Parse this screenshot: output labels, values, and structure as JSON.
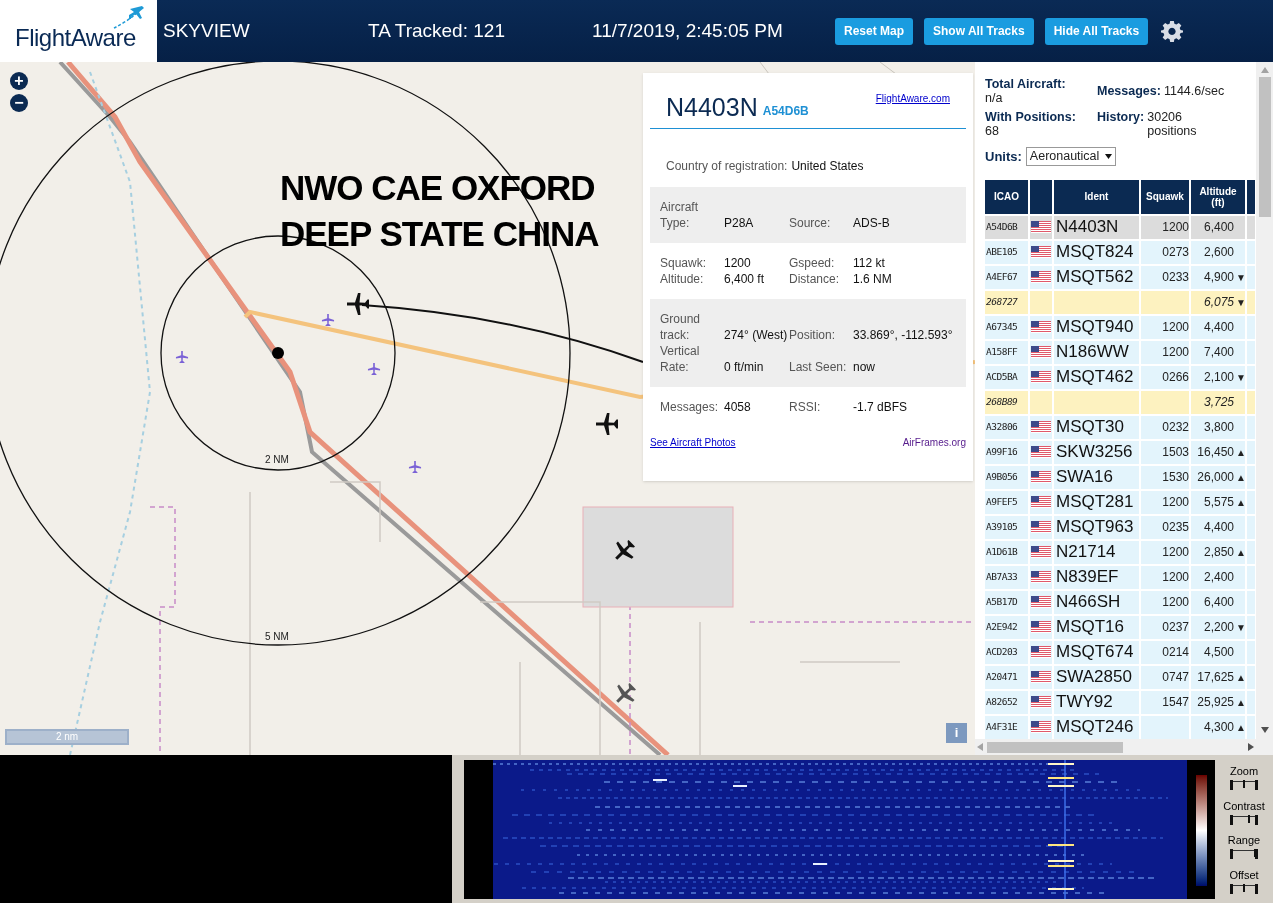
{
  "header": {
    "logo": "FlightAware",
    "title": "SKYVIEW",
    "tracked": "TA Tracked: 121",
    "datetime": "11/7/2019, 2:45:05 PM",
    "buttons": [
      "Reset Map",
      "Show All Tracks",
      "Hide All Tracks"
    ]
  },
  "map": {
    "zoom_buttons": [
      "+",
      "−"
    ],
    "annotation": [
      "NWO CAE OXFORD",
      "DEEP STATE CHINA"
    ],
    "rings": [
      "2 NM",
      "5 NM"
    ],
    "scale": "2 nm",
    "info": "i"
  },
  "popup": {
    "ident": "N4403N",
    "icao": "A54D6B",
    "link": "FlightAware.com",
    "country_label": "Country of registration:",
    "country": "United States",
    "sections": [
      {
        "shaded": true,
        "rows": [
          [
            "Aircraft Type:",
            "P28A",
            "Source:",
            "ADS-B"
          ]
        ]
      },
      {
        "shaded": false,
        "rows": [
          [
            "Squawk:",
            "1200",
            "Gspeed:",
            "112 kt"
          ],
          [
            "Altitude:",
            "6,400 ft",
            "Distance:",
            "1.6 NM"
          ]
        ]
      },
      {
        "shaded": true,
        "rows": [
          [
            "Ground track:",
            "274° (West)",
            "Position:",
            "33.869°, -112.593°"
          ],
          [
            "Vertical Rate:",
            "0 ft/min",
            "Last Seen:",
            "now"
          ]
        ]
      },
      {
        "shaded": false,
        "rows": [
          [
            "Messages:",
            "4058",
            "RSSI:",
            "-1.7 dBFS"
          ]
        ]
      }
    ],
    "photos_link": "See Aircraft Photos",
    "airframes_link": "AirFrames.org"
  },
  "stats": {
    "total_label": "Total Aircraft:",
    "total": "n/a",
    "messages_label": "Messages:",
    "messages": "1144.6/sec",
    "positions_label": "With Positions:",
    "positions": "68",
    "history_label": "History:",
    "history": "30206 positions",
    "units_label": "Units:",
    "units": "Aeronautical"
  },
  "table": {
    "columns": [
      "ICAO",
      "Ident",
      "Squawk",
      "Altitude (ft)"
    ],
    "rows": [
      {
        "kind": "adsb",
        "selected": true,
        "icao": "A54D6B",
        "ident": "N4403N",
        "squawk": "1200",
        "altitude": "6,400"
      },
      {
        "kind": "adsb",
        "selected": false,
        "icao": "ABE105",
        "ident": "MSQT824",
        "squawk": "0273",
        "altitude": "2,600"
      },
      {
        "kind": "adsb",
        "selected": false,
        "icao": "A4EF67",
        "ident": "MSQT562",
        "squawk": "0233",
        "altitude": "4,900",
        "trend": "▼"
      },
      {
        "kind": "mlat",
        "selected": false,
        "icao": "268727",
        "altitude": "6,075",
        "trend": "▼"
      },
      {
        "kind": "adsb",
        "selected": false,
        "icao": "A67345",
        "ident": "MSQT940",
        "squawk": "1200",
        "altitude": "4,400"
      },
      {
        "kind": "adsb",
        "selected": false,
        "icao": "A158FF",
        "ident": "N186WW",
        "squawk": "1200",
        "altitude": "7,400"
      },
      {
        "kind": "adsb",
        "selected": false,
        "icao": "ACD5BA",
        "ident": "MSQT462",
        "squawk": "0266",
        "altitude": "2,100",
        "trend": "▼"
      },
      {
        "kind": "mlat",
        "selected": false,
        "icao": "268B89",
        "altitude": "3,725"
      },
      {
        "kind": "adsb",
        "selected": false,
        "icao": "A32806",
        "ident": "MSQT30",
        "squawk": "0232",
        "altitude": "3,800"
      },
      {
        "kind": "adsb",
        "selected": false,
        "icao": "A99F16",
        "ident": "SKW3256",
        "squawk": "1503",
        "altitude": "16,450",
        "trend": "▲"
      },
      {
        "kind": "adsb",
        "selected": false,
        "icao": "A9B056",
        "ident": "SWA16",
        "squawk": "1530",
        "altitude": "26,000",
        "trend": "▲"
      },
      {
        "kind": "adsb",
        "selected": false,
        "icao": "A9FEF5",
        "ident": "MSQT281",
        "squawk": "1200",
        "altitude": "5,575",
        "trend": "▲"
      },
      {
        "kind": "adsb",
        "selected": false,
        "icao": "A39105",
        "ident": "MSQT963",
        "squawk": "0235",
        "altitude": "4,400"
      },
      {
        "kind": "adsb",
        "selected": false,
        "icao": "A1D61B",
        "ident": "N21714",
        "squawk": "1200",
        "altitude": "2,850",
        "trend": "▲"
      },
      {
        "kind": "adsb",
        "selected": false,
        "icao": "AB7A33",
        "ident": "N839EF",
        "squawk": "1200",
        "altitude": "2,400"
      },
      {
        "kind": "adsb",
        "selected": false,
        "icao": "A5B17D",
        "ident": "N466SH",
        "squawk": "1200",
        "altitude": "6,400"
      },
      {
        "kind": "adsb",
        "selected": false,
        "icao": "A2E942",
        "ident": "MSQT16",
        "squawk": "0237",
        "altitude": "2,200",
        "trend": "▼"
      },
      {
        "kind": "adsb",
        "selected": false,
        "icao": "ACD203",
        "ident": "MSQT674",
        "squawk": "0214",
        "altitude": "4,500"
      },
      {
        "kind": "adsb",
        "selected": false,
        "icao": "A20471",
        "ident": "SWA2850",
        "squawk": "0747",
        "altitude": "17,625",
        "trend": "▲"
      },
      {
        "kind": "adsb",
        "selected": false,
        "icao": "A82652",
        "ident": "TWY92",
        "squawk": "1547",
        "altitude": "25,925",
        "trend": "▲"
      },
      {
        "kind": "adsb",
        "selected": false,
        "icao": "A4F31E",
        "ident": "MSQT246",
        "altitude": "4,300",
        "trend": "▲"
      }
    ]
  },
  "spectrum": {
    "controls": [
      {
        "label": "Zoom",
        "level": 0.5
      },
      {
        "label": "Contrast",
        "level": 0.75
      },
      {
        "label": "Range",
        "level": 1
      },
      {
        "label": "Offset",
        "level": 0.5
      }
    ]
  }
}
